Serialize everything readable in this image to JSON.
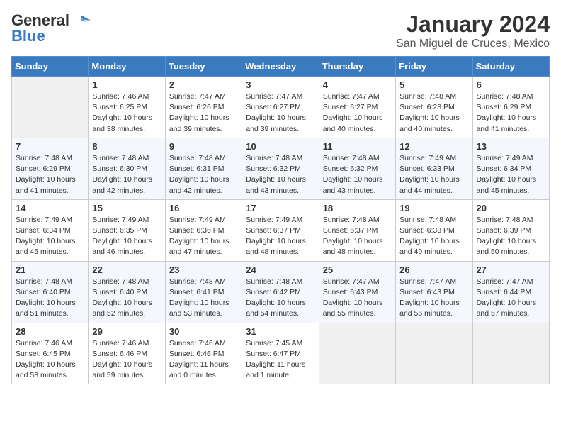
{
  "header": {
    "logo_line1": "General",
    "logo_line2": "Blue",
    "month": "January 2024",
    "location": "San Miguel de Cruces, Mexico"
  },
  "days_of_week": [
    "Sunday",
    "Monday",
    "Tuesday",
    "Wednesday",
    "Thursday",
    "Friday",
    "Saturday"
  ],
  "weeks": [
    [
      {
        "day": "",
        "empty": true
      },
      {
        "day": "1",
        "sunrise": "7:46 AM",
        "sunset": "6:25 PM",
        "daylight": "10 hours and 38 minutes."
      },
      {
        "day": "2",
        "sunrise": "7:47 AM",
        "sunset": "6:26 PM",
        "daylight": "10 hours and 39 minutes."
      },
      {
        "day": "3",
        "sunrise": "7:47 AM",
        "sunset": "6:27 PM",
        "daylight": "10 hours and 39 minutes."
      },
      {
        "day": "4",
        "sunrise": "7:47 AM",
        "sunset": "6:27 PM",
        "daylight": "10 hours and 40 minutes."
      },
      {
        "day": "5",
        "sunrise": "7:48 AM",
        "sunset": "6:28 PM",
        "daylight": "10 hours and 40 minutes."
      },
      {
        "day": "6",
        "sunrise": "7:48 AM",
        "sunset": "6:29 PM",
        "daylight": "10 hours and 41 minutes."
      }
    ],
    [
      {
        "day": "7",
        "sunrise": "7:48 AM",
        "sunset": "6:29 PM",
        "daylight": "10 hours and 41 minutes."
      },
      {
        "day": "8",
        "sunrise": "7:48 AM",
        "sunset": "6:30 PM",
        "daylight": "10 hours and 42 minutes."
      },
      {
        "day": "9",
        "sunrise": "7:48 AM",
        "sunset": "6:31 PM",
        "daylight": "10 hours and 42 minutes."
      },
      {
        "day": "10",
        "sunrise": "7:48 AM",
        "sunset": "6:32 PM",
        "daylight": "10 hours and 43 minutes."
      },
      {
        "day": "11",
        "sunrise": "7:48 AM",
        "sunset": "6:32 PM",
        "daylight": "10 hours and 43 minutes."
      },
      {
        "day": "12",
        "sunrise": "7:49 AM",
        "sunset": "6:33 PM",
        "daylight": "10 hours and 44 minutes."
      },
      {
        "day": "13",
        "sunrise": "7:49 AM",
        "sunset": "6:34 PM",
        "daylight": "10 hours and 45 minutes."
      }
    ],
    [
      {
        "day": "14",
        "sunrise": "7:49 AM",
        "sunset": "6:34 PM",
        "daylight": "10 hours and 45 minutes."
      },
      {
        "day": "15",
        "sunrise": "7:49 AM",
        "sunset": "6:35 PM",
        "daylight": "10 hours and 46 minutes."
      },
      {
        "day": "16",
        "sunrise": "7:49 AM",
        "sunset": "6:36 PM",
        "daylight": "10 hours and 47 minutes."
      },
      {
        "day": "17",
        "sunrise": "7:49 AM",
        "sunset": "6:37 PM",
        "daylight": "10 hours and 48 minutes."
      },
      {
        "day": "18",
        "sunrise": "7:48 AM",
        "sunset": "6:37 PM",
        "daylight": "10 hours and 48 minutes."
      },
      {
        "day": "19",
        "sunrise": "7:48 AM",
        "sunset": "6:38 PM",
        "daylight": "10 hours and 49 minutes."
      },
      {
        "day": "20",
        "sunrise": "7:48 AM",
        "sunset": "6:39 PM",
        "daylight": "10 hours and 50 minutes."
      }
    ],
    [
      {
        "day": "21",
        "sunrise": "7:48 AM",
        "sunset": "6:40 PM",
        "daylight": "10 hours and 51 minutes."
      },
      {
        "day": "22",
        "sunrise": "7:48 AM",
        "sunset": "6:40 PM",
        "daylight": "10 hours and 52 minutes."
      },
      {
        "day": "23",
        "sunrise": "7:48 AM",
        "sunset": "6:41 PM",
        "daylight": "10 hours and 53 minutes."
      },
      {
        "day": "24",
        "sunrise": "7:48 AM",
        "sunset": "6:42 PM",
        "daylight": "10 hours and 54 minutes."
      },
      {
        "day": "25",
        "sunrise": "7:47 AM",
        "sunset": "6:43 PM",
        "daylight": "10 hours and 55 minutes."
      },
      {
        "day": "26",
        "sunrise": "7:47 AM",
        "sunset": "6:43 PM",
        "daylight": "10 hours and 56 minutes."
      },
      {
        "day": "27",
        "sunrise": "7:47 AM",
        "sunset": "6:44 PM",
        "daylight": "10 hours and 57 minutes."
      }
    ],
    [
      {
        "day": "28",
        "sunrise": "7:46 AM",
        "sunset": "6:45 PM",
        "daylight": "10 hours and 58 minutes."
      },
      {
        "day": "29",
        "sunrise": "7:46 AM",
        "sunset": "6:46 PM",
        "daylight": "10 hours and 59 minutes."
      },
      {
        "day": "30",
        "sunrise": "7:46 AM",
        "sunset": "6:46 PM",
        "daylight": "11 hours and 0 minutes."
      },
      {
        "day": "31",
        "sunrise": "7:45 AM",
        "sunset": "6:47 PM",
        "daylight": "11 hours and 1 minute."
      },
      {
        "day": "",
        "empty": true
      },
      {
        "day": "",
        "empty": true
      },
      {
        "day": "",
        "empty": true
      }
    ]
  ]
}
